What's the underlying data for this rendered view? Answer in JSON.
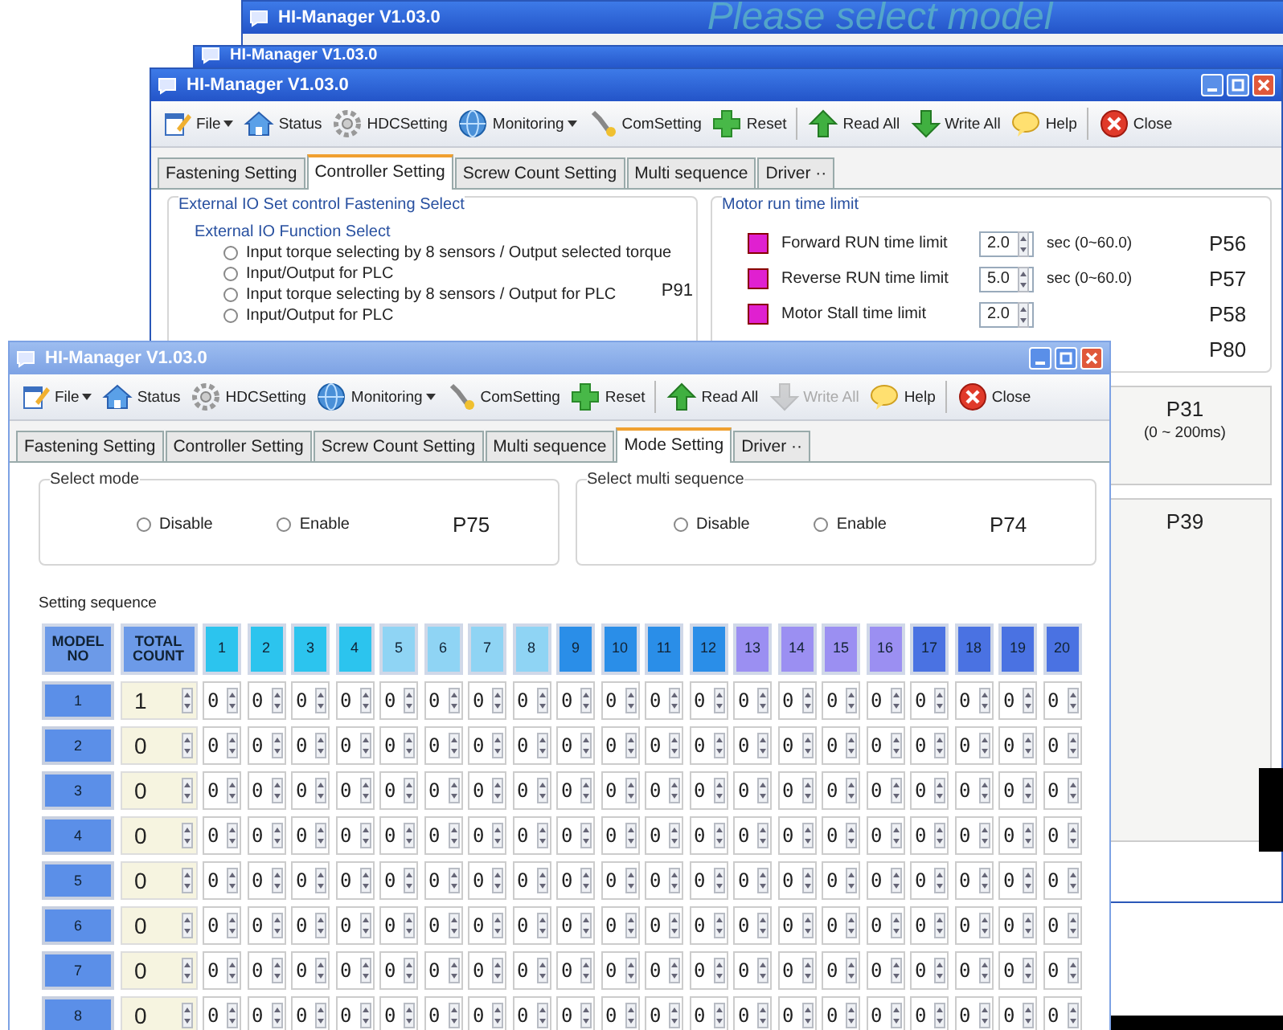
{
  "back_window": {
    "title": "HI-Manager V1.03.0",
    "message": "Please select model"
  },
  "middle_window": {
    "title": "HI-Manager V1.03.0"
  },
  "controller_window": {
    "title": "HI-Manager V1.03.0",
    "toolbar": [
      {
        "kind": "file",
        "label": "File",
        "dropdown": true,
        "disabled": false
      },
      {
        "kind": "status",
        "label": "Status",
        "dropdown": false,
        "disabled": false
      },
      {
        "kind": "hdc",
        "label": "HDCSetting",
        "dropdown": false,
        "disabled": false
      },
      {
        "kind": "monitoring",
        "label": "Monitoring",
        "dropdown": true,
        "disabled": false
      },
      {
        "kind": "com",
        "label": "ComSetting",
        "dropdown": false,
        "disabled": false
      },
      {
        "kind": "reset",
        "label": "Reset",
        "dropdown": false,
        "disabled": false
      },
      {
        "kind": "read",
        "label": "Read All",
        "dropdown": false,
        "disabled": false
      },
      {
        "kind": "write",
        "label": "Write All",
        "dropdown": false,
        "disabled": false
      },
      {
        "kind": "help",
        "label": "Help",
        "dropdown": false,
        "disabled": false
      },
      {
        "kind": "close",
        "label": "Close",
        "dropdown": false,
        "disabled": false
      }
    ],
    "tabs": [
      {
        "label": "Fastening Setting",
        "selected": false
      },
      {
        "label": "Controller Setting",
        "selected": true
      },
      {
        "label": "Screw Count Setting",
        "selected": false
      },
      {
        "label": "Multi sequence",
        "selected": false
      },
      {
        "label": "Driver ··",
        "selected": false
      }
    ],
    "io_group": {
      "title": "External IO Set control Fastening Select",
      "subgroup_title": "External IO Function Select",
      "code": "P91",
      "options": [
        {
          "label": "Input torque selecting by 8 sensors / Output selected torque",
          "selected": false
        },
        {
          "label": "Input/Output for PLC",
          "selected": false
        },
        {
          "label": "Input torque selecting by 8 sensors / Output for PLC",
          "selected": false
        },
        {
          "label": "Input/Output for PLC",
          "selected": false
        }
      ]
    },
    "run_time_group": {
      "title": "Motor run time limit",
      "rows": [
        {
          "label": "Forward RUN time limit",
          "value": "2.0",
          "range": "sec (0~60.0)",
          "code": "P56"
        },
        {
          "label": "Reverse RUN time limit",
          "value": "5.0",
          "range": "sec (0~60.0)",
          "code": "P57"
        },
        {
          "label": "Motor Stall time limit",
          "value": "2.0",
          "range": "",
          "code": "P58"
        }
      ],
      "extra_code": "P80"
    },
    "timing_panel": {
      "code": "P31",
      "range": "(0 ~ 200ms)"
    },
    "bottom_panel": {
      "code": "P39"
    }
  },
  "mode_window": {
    "title": "HI-Manager V1.03.0",
    "toolbar": [
      {
        "kind": "file",
        "label": "File",
        "dropdown": true,
        "disabled": false
      },
      {
        "kind": "status",
        "label": "Status",
        "dropdown": false,
        "disabled": false
      },
      {
        "kind": "hdc",
        "label": "HDCSetting",
        "dropdown": false,
        "disabled": false
      },
      {
        "kind": "monitoring",
        "label": "Monitoring",
        "dropdown": true,
        "disabled": false
      },
      {
        "kind": "com",
        "label": "ComSetting",
        "dropdown": false,
        "disabled": false
      },
      {
        "kind": "reset",
        "label": "Reset",
        "dropdown": false,
        "disabled": false
      },
      {
        "kind": "read",
        "label": "Read All",
        "dropdown": false,
        "disabled": false
      },
      {
        "kind": "write",
        "label": "Write All",
        "dropdown": false,
        "disabled": true
      },
      {
        "kind": "help",
        "label": "Help",
        "dropdown": false,
        "disabled": false
      },
      {
        "kind": "close",
        "label": "Close",
        "dropdown": false,
        "disabled": false
      }
    ],
    "tabs": [
      {
        "label": "Fastening Setting",
        "selected": false
      },
      {
        "label": "Controller Setting",
        "selected": false
      },
      {
        "label": "Screw Count Setting",
        "selected": false
      },
      {
        "label": "Multi sequence",
        "selected": false
      },
      {
        "label": "Mode Setting",
        "selected": true
      },
      {
        "label": "Driver ··",
        "selected": false
      }
    ],
    "mode_groups": [
      {
        "title": "Select mode",
        "code": "P75",
        "options": [
          {
            "label": "Disable",
            "selected": false
          },
          {
            "label": "Enable",
            "selected": false
          }
        ]
      },
      {
        "title": "Select multi sequence",
        "code": "P74",
        "options": [
          {
            "label": "Disable",
            "selected": false
          },
          {
            "label": "Enable",
            "selected": false
          }
        ]
      }
    ],
    "sequence": {
      "title": "Setting sequence",
      "model_header": "MODEL NO",
      "count_header": "TOTAL COUNT",
      "columns": [
        {
          "label": "1",
          "color": "#2cc4ee"
        },
        {
          "label": "2",
          "color": "#2cc4ee"
        },
        {
          "label": "3",
          "color": "#2cc4ee"
        },
        {
          "label": "4",
          "color": "#2cc4ee"
        },
        {
          "label": "5",
          "color": "#8fd4f4"
        },
        {
          "label": "6",
          "color": "#8fd4f4"
        },
        {
          "label": "7",
          "color": "#8fd4f4"
        },
        {
          "label": "8",
          "color": "#8fd4f4"
        },
        {
          "label": "9",
          "color": "#2a8ee8"
        },
        {
          "label": "10",
          "color": "#2a8ee8"
        },
        {
          "label": "11",
          "color": "#2a8ee8"
        },
        {
          "label": "12",
          "color": "#2a8ee8"
        },
        {
          "label": "13",
          "color": "#9b8ff2"
        },
        {
          "label": "14",
          "color": "#9b8ff2"
        },
        {
          "label": "15",
          "color": "#9b8ff2"
        },
        {
          "label": "16",
          "color": "#9b8ff2"
        },
        {
          "label": "17",
          "color": "#4a72e2"
        },
        {
          "label": "18",
          "color": "#4a72e2"
        },
        {
          "label": "19",
          "color": "#4a72e2"
        },
        {
          "label": "20",
          "color": "#4a72e2"
        }
      ],
      "rows": [
        {
          "model": "1",
          "total": "1",
          "cells": [
            "0",
            "0",
            "0",
            "0",
            "0",
            "0",
            "0",
            "0",
            "0",
            "0",
            "0",
            "0",
            "0",
            "0",
            "0",
            "0",
            "0",
            "0",
            "0",
            "0"
          ]
        },
        {
          "model": "2",
          "total": "0",
          "cells": [
            "0",
            "0",
            "0",
            "0",
            "0",
            "0",
            "0",
            "0",
            "0",
            "0",
            "0",
            "0",
            "0",
            "0",
            "0",
            "0",
            "0",
            "0",
            "0",
            "0"
          ]
        },
        {
          "model": "3",
          "total": "0",
          "cells": [
            "0",
            "0",
            "0",
            "0",
            "0",
            "0",
            "0",
            "0",
            "0",
            "0",
            "0",
            "0",
            "0",
            "0",
            "0",
            "0",
            "0",
            "0",
            "0",
            "0"
          ]
        },
        {
          "model": "4",
          "total": "0",
          "cells": [
            "0",
            "0",
            "0",
            "0",
            "0",
            "0",
            "0",
            "0",
            "0",
            "0",
            "0",
            "0",
            "0",
            "0",
            "0",
            "0",
            "0",
            "0",
            "0",
            "0"
          ]
        },
        {
          "model": "5",
          "total": "0",
          "cells": [
            "0",
            "0",
            "0",
            "0",
            "0",
            "0",
            "0",
            "0",
            "0",
            "0",
            "0",
            "0",
            "0",
            "0",
            "0",
            "0",
            "0",
            "0",
            "0",
            "0"
          ]
        },
        {
          "model": "6",
          "total": "0",
          "cells": [
            "0",
            "0",
            "0",
            "0",
            "0",
            "0",
            "0",
            "0",
            "0",
            "0",
            "0",
            "0",
            "0",
            "0",
            "0",
            "0",
            "0",
            "0",
            "0",
            "0"
          ]
        },
        {
          "model": "7",
          "total": "0",
          "cells": [
            "0",
            "0",
            "0",
            "0",
            "0",
            "0",
            "0",
            "0",
            "0",
            "0",
            "0",
            "0",
            "0",
            "0",
            "0",
            "0",
            "0",
            "0",
            "0",
            "0"
          ]
        },
        {
          "model": "8",
          "total": "0",
          "cells": [
            "0",
            "0",
            "0",
            "0",
            "0",
            "0",
            "0",
            "0",
            "0",
            "0",
            "0",
            "0",
            "0",
            "0",
            "0",
            "0",
            "0",
            "0",
            "0",
            "0"
          ]
        }
      ]
    }
  }
}
